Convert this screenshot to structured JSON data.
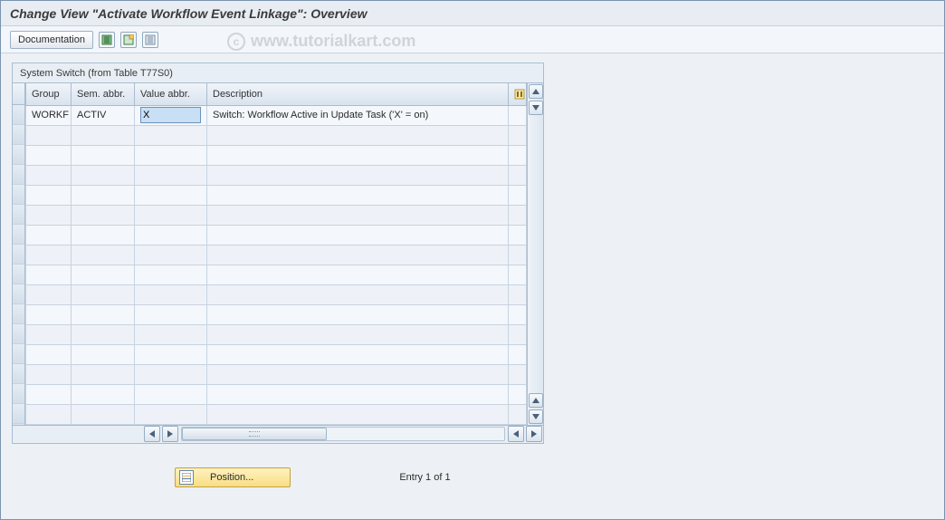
{
  "title": "Change View \"Activate Workflow Event Linkage\": Overview",
  "toolbar": {
    "documentation_label": "Documentation"
  },
  "watermark": "www.tutorialkart.com",
  "panel": {
    "title": "System Switch (from Table T77S0)",
    "columns": {
      "group": "Group",
      "sem": "Sem. abbr.",
      "val": "Value abbr.",
      "desc": "Description"
    },
    "rows": [
      {
        "group": "WORKF",
        "sem": "ACTIV",
        "val": "X",
        "desc": "Switch: Workflow Active in Update Task ('X' = on)"
      }
    ]
  },
  "footer": {
    "position_label": "Position...",
    "entry_text": "Entry 1 of 1"
  }
}
